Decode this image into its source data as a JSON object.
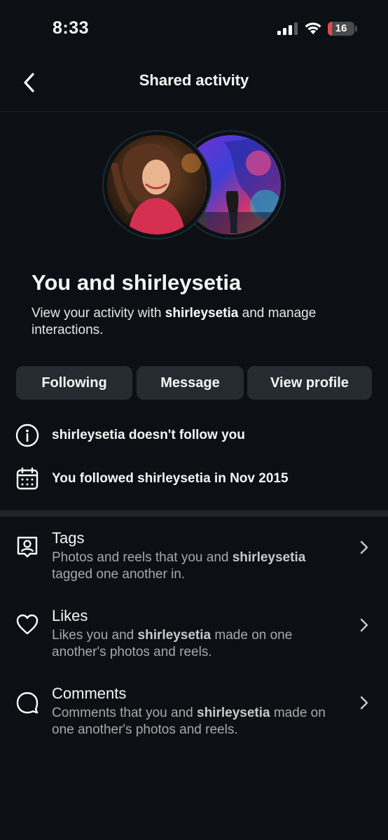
{
  "status_bar": {
    "time": "8:33",
    "battery_level": "16",
    "battery_color": "#e5484d",
    "icons": [
      "cellular-signal-icon",
      "wifi-icon",
      "battery-icon"
    ]
  },
  "nav": {
    "title": "Shared activity",
    "back_icon": "chevron-left-icon"
  },
  "hero": {
    "headline": "You and shirleysetia",
    "subtext_before": "View your activity with ",
    "subtext_username": "shirleysetia",
    "subtext_after": " and manage interactions."
  },
  "actions": {
    "following_label": "Following",
    "message_label": "Message",
    "view_profile_label": "View profile"
  },
  "info": {
    "follow_status": "shirleysetia doesn't follow you",
    "followed_since": "You followed shirleysetia in Nov 2015"
  },
  "sections": [
    {
      "title": "Tags",
      "desc_before": "Photos and reels that you and ",
      "username": "shirleysetia",
      "desc_after": " tagged one another in.",
      "icon": "tag-person-icon"
    },
    {
      "title": "Likes",
      "desc_before": "Likes you and ",
      "username": "shirleysetia",
      "desc_after": " made on one another's photos and reels.",
      "icon": "heart-icon"
    },
    {
      "title": "Comments",
      "desc_before": "Comments that you and ",
      "username": "shirleysetia",
      "desc_after": " made on one another's photos and reels.",
      "icon": "comment-bubble-icon"
    }
  ],
  "colors": {
    "background": "#0c1014",
    "button": "#262b31",
    "secondary_text": "#a8a8a8"
  }
}
